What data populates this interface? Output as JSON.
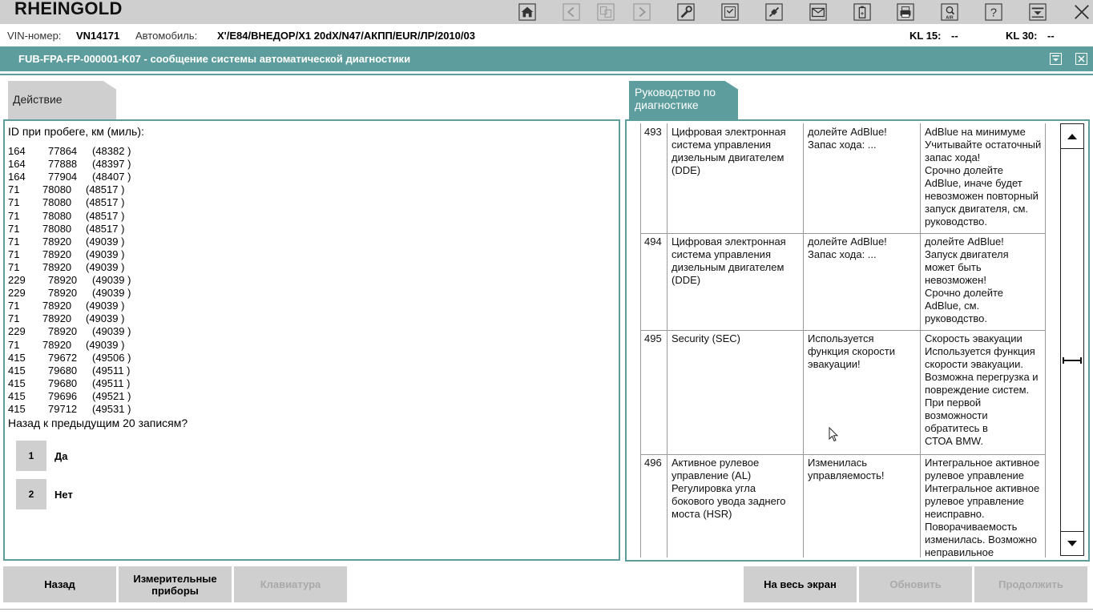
{
  "app": {
    "title": "RHEINGOLD"
  },
  "toolbar": {
    "icons": [
      "home-icon",
      "back-arrow-icon",
      "document-swap-icon",
      "forward-arrow-icon",
      "wrench-icon",
      "service-plan-icon",
      "plug-icon",
      "mail-icon",
      "battery-icon",
      "printer-icon",
      "air-search-icon",
      "help-icon",
      "dropdown-menu-icon",
      "close-icon"
    ]
  },
  "vehicle": {
    "vin_label": "VIN-номер:",
    "vin": "VN14171",
    "car_label": "Автомобиль:",
    "car": "X'/E84/ВНЕДОР/X1 20dX/N47/АКПП/EUR/ЛР/2010/03",
    "kl15_label": "KL 15:",
    "kl15": "--",
    "kl30_label": "KL 30:",
    "kl30": "--"
  },
  "window": {
    "title": "FUB-FPA-FP-000001-K07  -  сообщение системы автоматической диагностики"
  },
  "tabs": {
    "action": "Действие",
    "guide": "Руководство по диагностике"
  },
  "action": {
    "heading": "ID при пробеге, км (миль):",
    "rows": [
      {
        "id": "164",
        "km": "77864",
        "mi": "(48382 )"
      },
      {
        "id": "164",
        "km": "77888",
        "mi": "(48397 )"
      },
      {
        "id": "164",
        "km": "77904",
        "mi": "(48407 )"
      },
      {
        "id": "71",
        "km": "78080",
        "mi": "(48517 )"
      },
      {
        "id": "71",
        "km": "78080",
        "mi": "(48517 )"
      },
      {
        "id": "71",
        "km": "78080",
        "mi": "(48517 )"
      },
      {
        "id": "71",
        "km": "78080",
        "mi": "(48517 )"
      },
      {
        "id": "71",
        "km": "78920",
        "mi": "(49039 )"
      },
      {
        "id": "71",
        "km": "78920",
        "mi": "(49039 )"
      },
      {
        "id": "71",
        "km": "78920",
        "mi": "(49039 )"
      },
      {
        "id": "229",
        "km": "78920",
        "mi": "(49039 )"
      },
      {
        "id": "229",
        "km": "78920",
        "mi": "(49039 )"
      },
      {
        "id": "71",
        "km": "78920",
        "mi": "(49039 )"
      },
      {
        "id": "71",
        "km": "78920",
        "mi": "(49039 )"
      },
      {
        "id": "229",
        "km": "78920",
        "mi": "(49039 )"
      },
      {
        "id": "71",
        "km": "78920",
        "mi": "(49039 )"
      },
      {
        "id": "415",
        "km": "79672",
        "mi": "(49506 )"
      },
      {
        "id": "415",
        "km": "79680",
        "mi": "(49511 )"
      },
      {
        "id": "415",
        "km": "79680",
        "mi": "(49511 )"
      },
      {
        "id": "415",
        "km": "79696",
        "mi": "(49521 )"
      },
      {
        "id": "415",
        "km": "79712",
        "mi": "(49531 )"
      }
    ],
    "question": "Назад к предыдущим 20 записям?",
    "options": [
      {
        "num": "1",
        "label": "Да"
      },
      {
        "num": "2",
        "label": "Нет"
      }
    ]
  },
  "guide_table": [
    {
      "num": "493",
      "system": "Цифровая электронная\nсистема управления\nдизельным двигателем\n(DDE)",
      "message": "долейте AdBlue!\nЗапас хода: ...",
      "description": "AdBlue на минимуме\nУчитывайте остаточный\nзапас хода!\nСрочно долейте\nAdBlue, иначе будет\nневозможен повторный\nзапуск двигателя, см.\nруководство."
    },
    {
      "num": "494",
      "system": "Цифровая электронная\nсистема управления\nдизельным двигателем\n(DDE)",
      "message": "долейте AdBlue!\nЗапас хода: ...",
      "description": "долейте AdBlue!\nЗапуск двигателя\nможет быть\nневозможен!\nСрочно долейте\nAdBlue, см.\nруководство."
    },
    {
      "num": "495",
      "system": "Security (SEC)",
      "message": "Используется\nфункция скорости\nэвакуации!",
      "description": "Скорость эвакуации\nИспользуется функция\nскорости эвакуации.\nВозможна перегрузка и\nповреждение систем.\nПри первой\nвозможности\nобратитесь в\nСТОА BMW."
    },
    {
      "num": "496",
      "system": "Активное рулевое\nуправление (AL)\nРегулировка угла\nбокового увода заднего\nмоста (HSR)",
      "message": "Изменилась\nуправляемость!",
      "description": "Интегральное активное\nрулевое управление\nИнтегральное активное\nрулевое управление\nнеисправно.\nПоворачиваемость\nизменилась. Возможно\nнеправильное"
    }
  ],
  "buttons": {
    "back": "Назад",
    "instruments": "Измерительные приборы",
    "keyboard": "Клавиатура",
    "fullscreen": "На весь экран",
    "refresh": "Обновить",
    "continue": "Продолжить"
  }
}
